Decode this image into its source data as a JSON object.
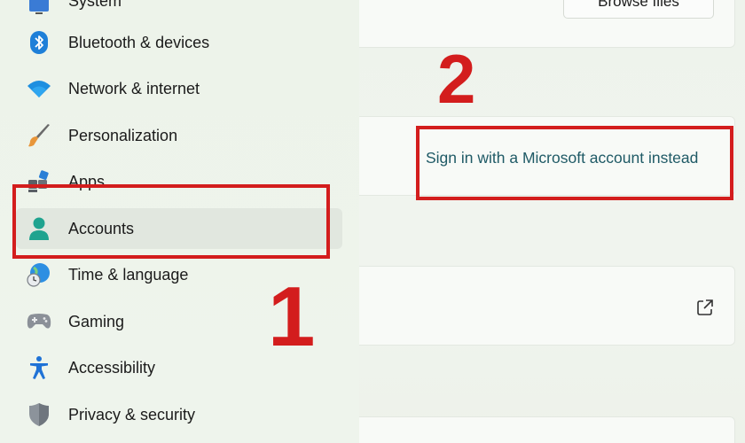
{
  "sidebar": {
    "items": [
      {
        "label": "System",
        "icon": "system-icon"
      },
      {
        "label": "Bluetooth & devices",
        "icon": "bluetooth-icon"
      },
      {
        "label": "Network & internet",
        "icon": "wifi-icon"
      },
      {
        "label": "Personalization",
        "icon": "paintbrush-icon"
      },
      {
        "label": "Apps",
        "icon": "apps-icon"
      },
      {
        "label": "Accounts",
        "icon": "person-icon",
        "selected": true
      },
      {
        "label": "Time & language",
        "icon": "globe-clock-icon"
      },
      {
        "label": "Gaming",
        "icon": "gamepad-icon"
      },
      {
        "label": "Accessibility",
        "icon": "accessibility-icon"
      },
      {
        "label": "Privacy & security",
        "icon": "shield-icon"
      }
    ]
  },
  "content": {
    "browse_button": "Browse files",
    "signin_link": "Sign in with a Microsoft account instead",
    "external_link_icon": "open-external-icon"
  },
  "annotations": {
    "step1": "1",
    "step2": "2",
    "color": "#d31d1d"
  },
  "colors": {
    "accent_link": "#1f5a66",
    "selected_bg": "#e1e7df"
  }
}
